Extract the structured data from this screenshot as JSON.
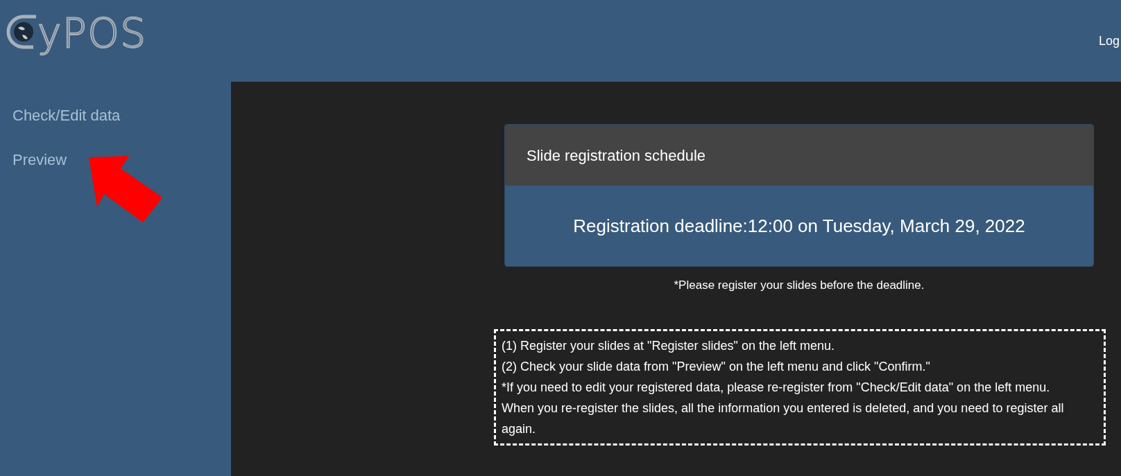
{
  "header": {
    "logo_text": "yPOS",
    "right_link": "Log"
  },
  "sidebar": {
    "items": [
      {
        "label": "Check/Edit data"
      },
      {
        "label": "Preview"
      }
    ]
  },
  "schedule_card": {
    "title": "Slide registration schedule",
    "deadline": "Registration deadline:12:00 on Tuesday, March 29, 2022"
  },
  "note": "*Please register your slides before the deadline.",
  "instructions": [
    "(1) Register your slides at \"Register slides\" on the left menu.",
    "(2) Check your slide data from \"Preview\" on the left menu and click \"Confirm.\"",
    "*If you need to edit your registered data, please re-register from \"Check/Edit data\" on the left menu. When you re-register the slides, all the information you entered is deleted, and you need to register all again."
  ]
}
